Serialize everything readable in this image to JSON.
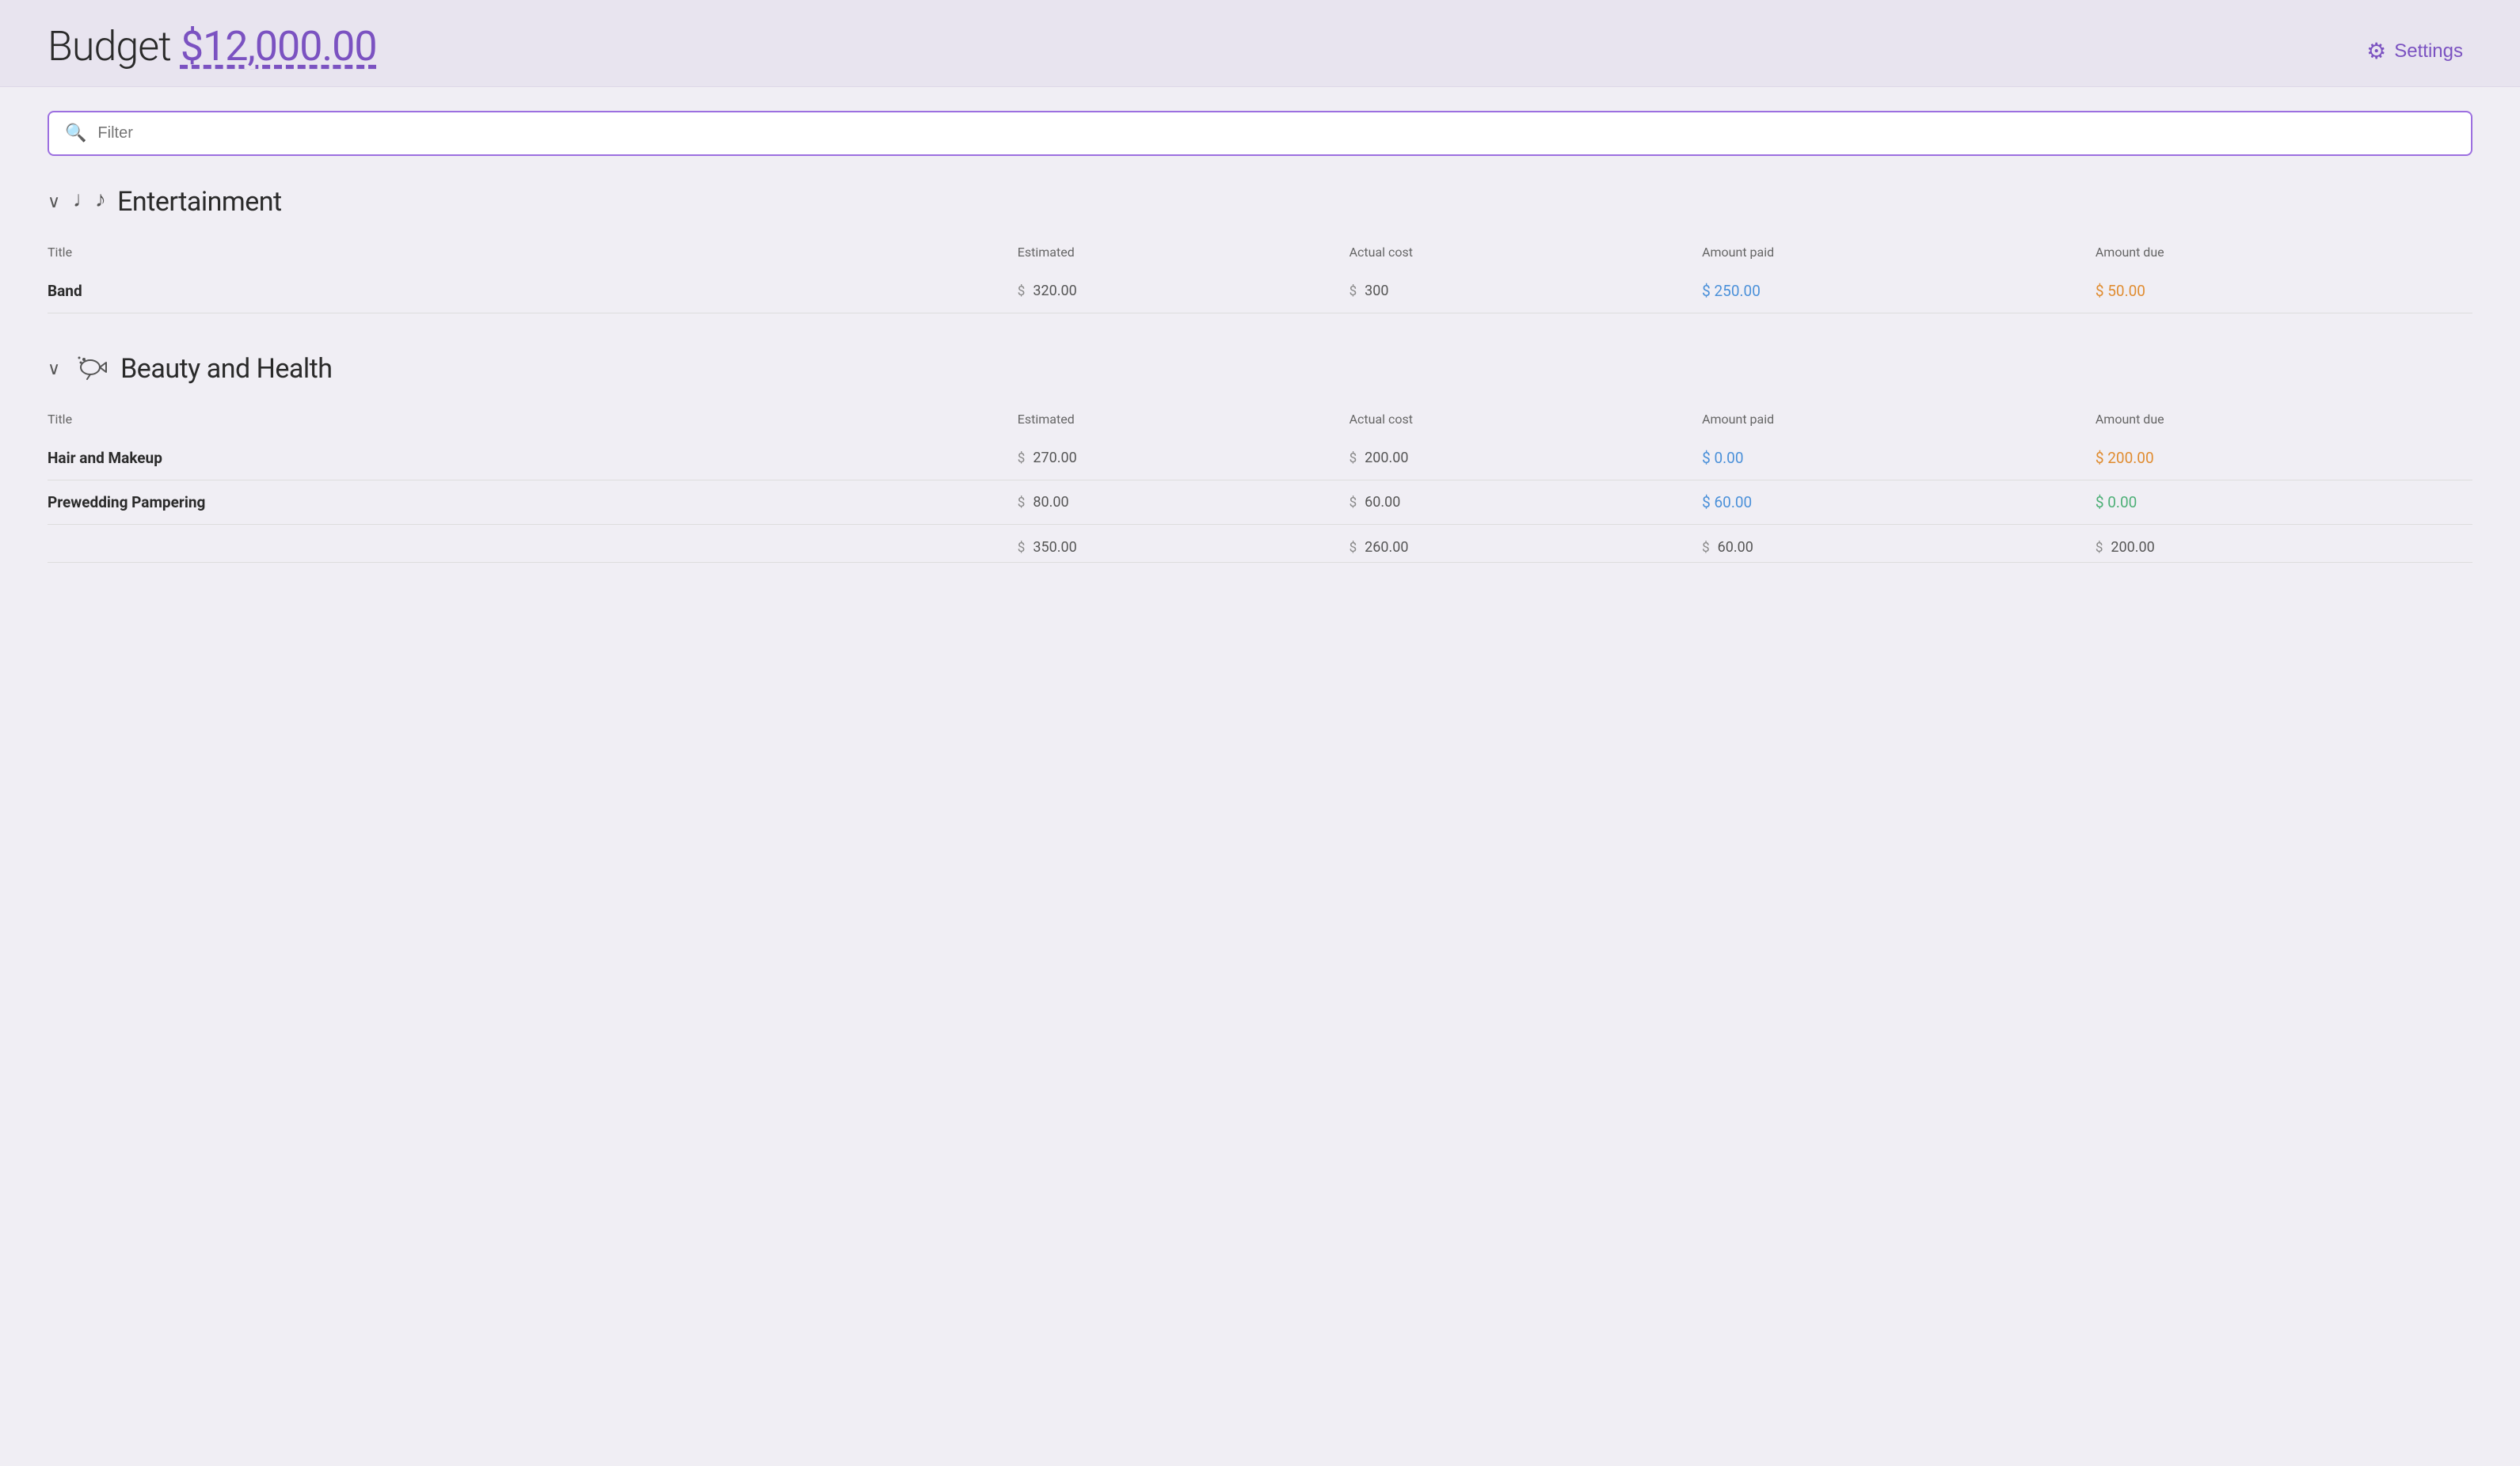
{
  "header": {
    "budget_label": "Budget",
    "budget_amount": "$12,000.00",
    "settings_label": "Settings"
  },
  "filter": {
    "placeholder": "Filter"
  },
  "categories": [
    {
      "id": "entertainment",
      "icon": "♩♪♫",
      "icon_label": "music-notes-icon",
      "title": "Entertainment",
      "expanded": true,
      "columns": {
        "title": "Title",
        "estimated": "Estimated",
        "actual_cost": "Actual cost",
        "amount_paid": "Amount paid",
        "amount_due": "Amount due"
      },
      "items": [
        {
          "title": "Band",
          "estimated": "320.00",
          "actual_cost": "300",
          "amount_paid": "250.00",
          "amount_due": "50.00",
          "paid_color": "blue",
          "due_color": "orange"
        }
      ]
    },
    {
      "id": "beauty-health",
      "icon": "💨",
      "icon_label": "hair-dryer-icon",
      "title": "Beauty and Health",
      "expanded": true,
      "columns": {
        "title": "Title",
        "estimated": "Estimated",
        "actual_cost": "Actual cost",
        "amount_paid": "Amount paid",
        "amount_due": "Amount due"
      },
      "items": [
        {
          "title": "Hair and Makeup",
          "estimated": "270.00",
          "actual_cost": "200.00",
          "amount_paid": "0.00",
          "amount_due": "200.00",
          "paid_color": "blue",
          "due_color": "orange"
        },
        {
          "title": "Prewedding Pampering",
          "estimated": "80.00",
          "actual_cost": "60.00",
          "amount_paid": "60.00",
          "amount_due": "0.00",
          "paid_color": "blue",
          "due_color": "green"
        }
      ],
      "totals": {
        "estimated": "350.00",
        "actual_cost": "260.00",
        "amount_paid": "60.00",
        "amount_due": "200.00"
      }
    }
  ]
}
